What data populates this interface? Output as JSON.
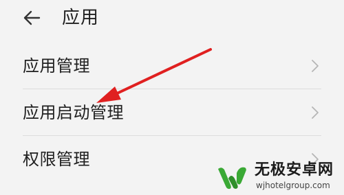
{
  "header": {
    "title": "应用",
    "back_icon": "back-arrow-icon"
  },
  "settings_list": [
    {
      "label": "应用管理",
      "icon": "chevron-right-icon"
    },
    {
      "label": "应用启动管理",
      "icon": "chevron-right-icon"
    },
    {
      "label": "权限管理",
      "icon": "chevron-right-icon"
    }
  ],
  "annotation": {
    "arrow_color": "#e02020",
    "points_to": "应用启动管理"
  },
  "watermark": {
    "name": "无极安卓网",
    "url": "wjhotelgroup.com",
    "logo_color": "#3aa935"
  }
}
